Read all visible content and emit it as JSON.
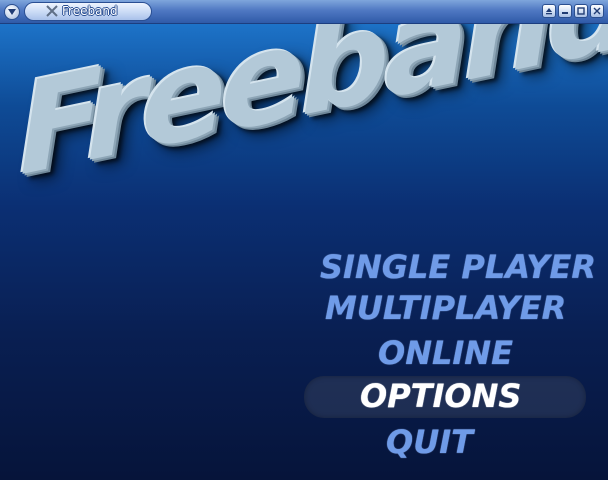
{
  "window": {
    "title": "Freeband"
  },
  "logo": {
    "text": "Freeband"
  },
  "menu": {
    "items": [
      {
        "label": "SINGLE PLAYER"
      },
      {
        "label": "MULTIPLAYER"
      },
      {
        "label": "ONLINE"
      },
      {
        "label": "OPTIONS",
        "selected": true
      },
      {
        "label": "QUIT"
      }
    ]
  },
  "colors": {
    "menu_item": "#6f9be8",
    "menu_item_selected": "#ffffff",
    "logo": "#b3c9d8",
    "background_top": "#1d73c8",
    "background_bottom": "#06143a"
  }
}
